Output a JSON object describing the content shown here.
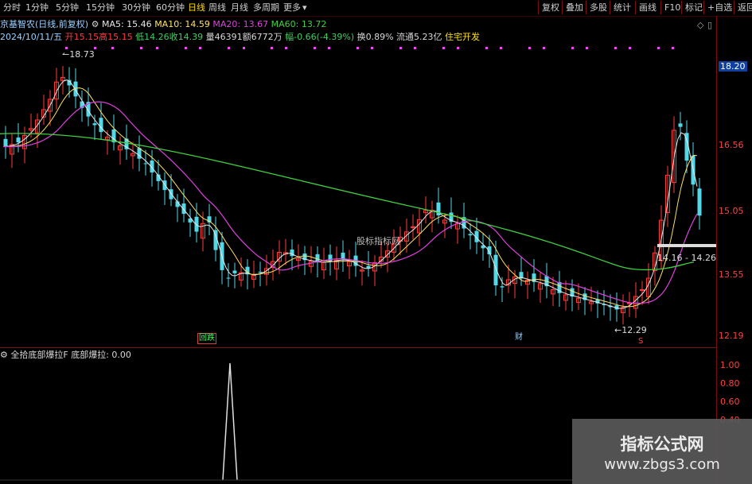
{
  "toolbar": {
    "period_tabs": [
      "分时",
      "1分钟",
      "5分钟",
      "15分钟",
      "30分钟",
      "60分钟",
      "日线",
      "周线",
      "月线",
      "多周期",
      "更多"
    ],
    "active_tab": "日线",
    "more_arrow": "▾",
    "right_buttons": [
      "复权",
      "叠加",
      "多股",
      "统计",
      "画线",
      "F10",
      "标记",
      "+自选",
      "返回"
    ]
  },
  "header": {
    "stock_name": "京基智农",
    "chart_mode": "(日线,前复权)",
    "settings_icon": "gear-icon",
    "ma5": "MA5: 15.46",
    "ma10": "MA10: 14.59",
    "ma20": "MA20: 13.67",
    "ma60": "MA60: 13.72",
    "date": "2024/10/11/五",
    "open": "开15.15",
    "high": "高15.15",
    "low": "低14.26",
    "close": "收14.39",
    "volume": "量46391",
    "amount": "额6772万",
    "change": "幅-0.66(-4.39%)",
    "turnover": "换0.89%",
    "float_cap": "流通5.23亿",
    "sector": "住宅开发",
    "corner_icons": [
      "◇",
      "▯"
    ]
  },
  "price_axis": [
    "18.20",
    "16.56",
    "15.05",
    "13.55",
    "12.19"
  ],
  "price_annotations": {
    "high": "18.73",
    "low": "12.29",
    "last_range": "14.16 - 14.26",
    "mid_label": "股标指标网"
  },
  "markers": {
    "left": "回跌",
    "right": "财",
    "s": "S"
  },
  "indicator": {
    "title": "全拾底部爆拉F",
    "value": "底部爆拉: 0.00",
    "axis": [
      "1.00",
      "0.80",
      "0.60",
      "0.40"
    ]
  },
  "watermark": {
    "line1": "指标公式网",
    "line2": "www.zbgs3.com"
  },
  "colors": {
    "bg": "#000000",
    "up": "#ff3c3c",
    "down": "#54d8e8",
    "ma5": "#e8e8e8",
    "ma10": "#ffe066",
    "ma20": "#e040e0",
    "ma60": "#40d040",
    "axis": "#7a1010"
  }
}
